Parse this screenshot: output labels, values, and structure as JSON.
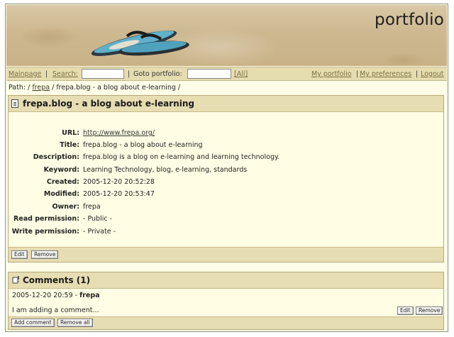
{
  "banner": {
    "title": "portfolio"
  },
  "nav": {
    "mainpage": "Mainpage",
    "sep1": "|",
    "search_label": "Search:",
    "search_value": "",
    "sep2": "|",
    "goto_label": "Goto portfolio:",
    "goto_value": "",
    "all_link": "[All]",
    "my_portfolio": "My portfolio",
    "sep3": "|",
    "my_preferences": "My preferences",
    "sep4": "|",
    "logout": "Logout"
  },
  "breadcrumb": {
    "prefix": "Path: /",
    "link": "frepa",
    "rest": "/ frepa.blog - a blog about e-learning /"
  },
  "item": {
    "title": "frepa.blog - a blog about e-learning",
    "fields": [
      {
        "label": "URL:",
        "value": "http://www.frepa.org/"
      },
      {
        "label": "Title:",
        "value": "frepa.blog - a blog about e-learning"
      },
      {
        "label": "Description:",
        "value": "frepa.blog is a blog on e-learning and learning technology."
      },
      {
        "label": "Keyword:",
        "value": "Learning Technology, blog, e-learning, standards"
      },
      {
        "label": "Created:",
        "value": "2005-12-20 20:52:28"
      },
      {
        "label": "Modified:",
        "value": "2005-12-20 20:53:47"
      },
      {
        "label": "Owner:",
        "value": "frepa"
      },
      {
        "label": "Read permission:",
        "value": "- Public -"
      },
      {
        "label": "Write permission:",
        "value": "- Private -"
      }
    ],
    "edit_label": "Edit",
    "remove_label": "Remove"
  },
  "comments": {
    "title": "Comments (1)",
    "entries": [
      {
        "timestamp": "2005-12-20 20:59",
        "separator": "-",
        "author": "frepa",
        "text": "I am adding a comment...",
        "edit_label": "Edit",
        "remove_label": "Remove"
      }
    ],
    "add_label": "Add comment",
    "remove_all_label": "Remove all"
  },
  "colors": {
    "nav_bg": "#e5dcb0",
    "panel_head_bg": "#e7ddb3",
    "panel_bg": "#fffde4",
    "link": "#7b6f40"
  },
  "icons": {
    "item": "document-icon",
    "comments": "comment-icon"
  }
}
